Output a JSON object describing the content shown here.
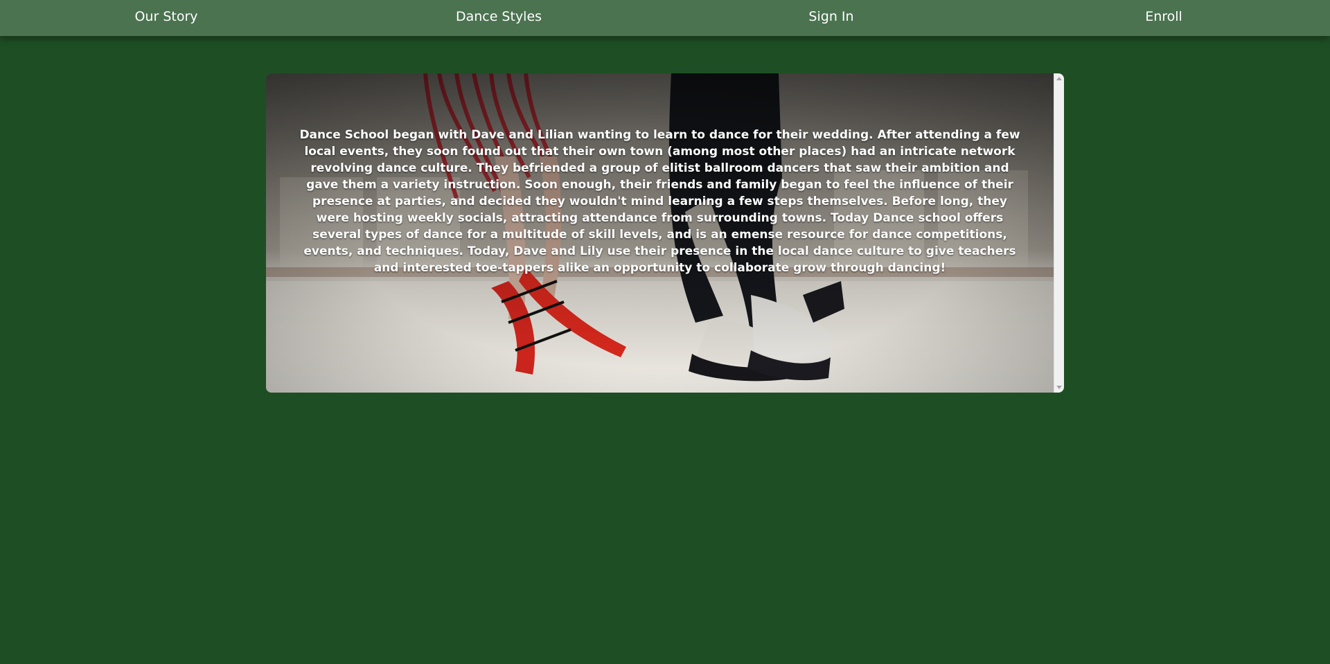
{
  "nav": {
    "items": [
      {
        "label": "Our Story"
      },
      {
        "label": "Dance Styles"
      },
      {
        "label": "Sign In"
      },
      {
        "label": "Enroll"
      }
    ]
  },
  "story": {
    "text": "Dance School began with Dave and Lilian wanting to learn to dance for their wedding. After attending a few local events, they soon found out that their own town (among most other places) had an intricate network revolving dance culture. They befriended a group of elitist ballroom dancers that saw their ambition and gave them a variety instruction. Soon enough, their friends and family began to feel the influence of their presence at parties, and decided they wouldn't mind learning a few steps themselves. Before long, they were hosting weekly socials, attracting attendance from surrounding towns. Today Dance school offers several types of dance for a multitude of skill levels, and is an emense resource for dance competitions, events, and techniques. Today, Dave and Lily use their presence in the local dance culture to give teachers and interested toe-tappers alike an opportunity to collaborate grow through dancing!"
  },
  "colors": {
    "background": "#1e4f24",
    "navbar": "#4b7350",
    "text": "#ffffff"
  }
}
